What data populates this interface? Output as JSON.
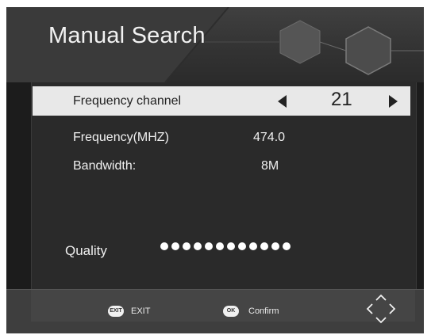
{
  "header": {
    "title": "Manual Search"
  },
  "channel_row": {
    "label": "Frequency channel",
    "value": "21"
  },
  "fields": [
    {
      "label": "Frequency(MHZ)",
      "value": "474.0"
    },
    {
      "label": "Bandwidth:",
      "value": "8M"
    }
  ],
  "quality": {
    "label": "Quality",
    "level_dots": 12
  },
  "footer": {
    "exit_badge": "EXIT",
    "exit_label": "EXIT",
    "ok_badge": "OK",
    "confirm_label": "Confirm",
    "nav_icon": "directional-pad-icon"
  },
  "colors": {
    "background": "#1c1c1c",
    "highlight": "#e8e8e8",
    "text": "#f0f0f0"
  }
}
